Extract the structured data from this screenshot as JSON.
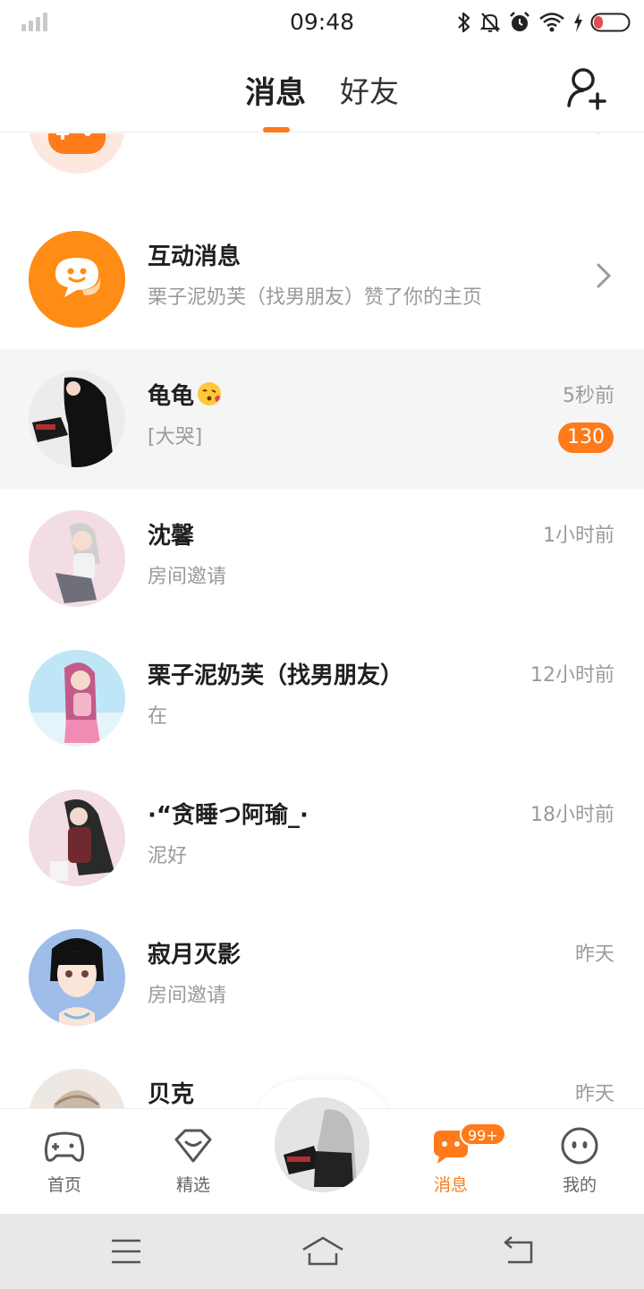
{
  "status_bar": {
    "time": "09:48"
  },
  "header": {
    "tabs": [
      {
        "label": "消息",
        "active": true
      },
      {
        "label": "好友",
        "active": false
      }
    ]
  },
  "conversations": [
    {
      "name": "",
      "preview": "",
      "time": "",
      "avatar_icon": "gamepad-icon"
    },
    {
      "name": "互动消息",
      "preview": "栗子泥奶芙（找男朋友）赞了你的主页",
      "time": "",
      "avatar_icon": "chat-smile-icon"
    },
    {
      "name": "龟龟",
      "preview": "[大哭]",
      "time": "5秒前",
      "unread": "130",
      "emoji": "kissing-face-emoji"
    },
    {
      "name": "沈馨",
      "preview": "房间邀请",
      "time": "1小时前"
    },
    {
      "name": "栗子泥奶芙（找男朋友）",
      "preview": "在",
      "time": "12小时前"
    },
    {
      "name": "·“贪睡つ阿瑜_·",
      "preview": "泥好",
      "time": "18小时前"
    },
    {
      "name": "寂月灭影",
      "preview": "房间邀请",
      "time": "昨天"
    },
    {
      "name": "贝克",
      "preview": "",
      "time": "昨天"
    }
  ],
  "bottom_nav": {
    "items": [
      {
        "label": "首页",
        "icon": "gamepad-icon"
      },
      {
        "label": "精选",
        "icon": "heart-gem-icon"
      },
      {
        "label": "消息",
        "icon": "message-bubble-icon",
        "badge": "99+",
        "active": true
      },
      {
        "label": "我的",
        "icon": "face-icon"
      }
    ]
  },
  "colors": {
    "accent": "#ff7a1a",
    "text_primary": "#1f1f1f",
    "text_secondary": "#9a9a9a",
    "highlight_row": "#f5f5f5"
  }
}
